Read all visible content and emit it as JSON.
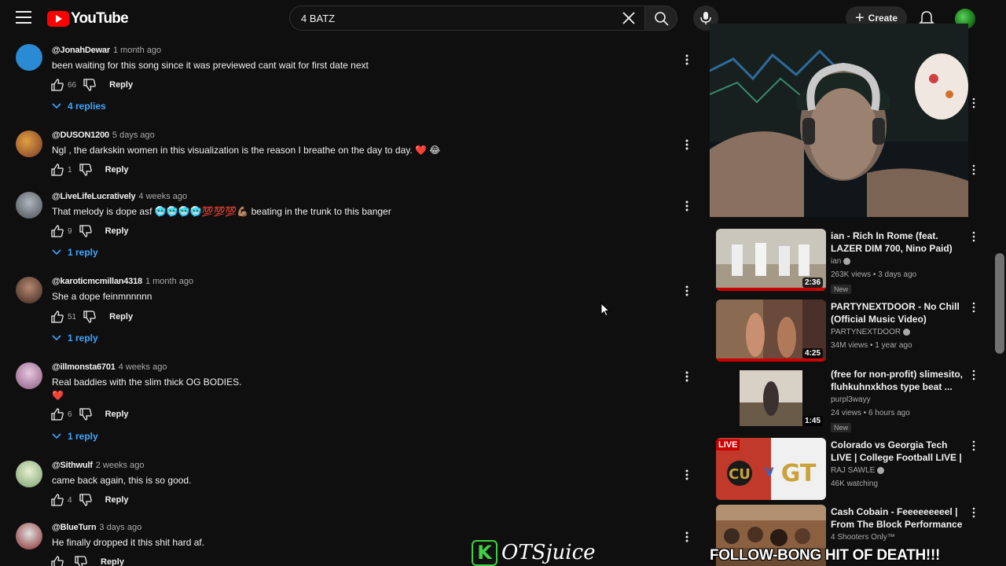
{
  "header": {
    "logo_text": "YouTube",
    "search_value": "4 BATZ",
    "create_label": "Create"
  },
  "comments": [
    {
      "author": "@JonahDewar",
      "time": "1 month ago",
      "text": "been waiting for this song since it was previewed cant wait for first date next",
      "likes": "66",
      "reply_label": "Reply",
      "replies": "4 replies",
      "avatar_color": "#2a8ad4"
    },
    {
      "author": "@DUSON1200",
      "time": "5 days ago",
      "text": "Ngl , the darkskin women in this visualization is the reason I breathe on the day to day. ❤️ 😂",
      "likes": "1",
      "reply_label": "Reply",
      "replies": "",
      "avatar_color": "#9b6b3a"
    },
    {
      "author": "@LiveLifeLucratively",
      "time": "4 weeks ago",
      "text": "That melody is dope asf 🥶🥶🥶🥶💯💯💯💪🏽 beating in the trunk  to this banger",
      "likes": "9",
      "reply_label": "Reply",
      "replies": "1 reply",
      "avatar_color": "#7a7f86"
    },
    {
      "author": "@karoticmcmillan4318",
      "time": "1 month ago",
      "text": "She a dope feinmnnnnn",
      "likes": "51",
      "reply_label": "Reply",
      "replies": "1 reply",
      "avatar_color": "#6b4a3a"
    },
    {
      "author": "@illmonsta6701",
      "time": "4 weeks ago",
      "text": "Real baddies with the slim thick OG BODIES.",
      "text2": "❤️",
      "likes": "6",
      "reply_label": "Reply",
      "replies": "1 reply",
      "avatar_color": "#c9a2c2"
    },
    {
      "author": "@Sithwulf",
      "time": "2 weeks ago",
      "text": "came back again, this is so good.",
      "likes": "4",
      "reply_label": "Reply",
      "replies": "",
      "avatar_color": "#a6c99a"
    },
    {
      "author": "@BlueTurn",
      "time": "3 days ago",
      "text": "He finally dropped it this shit hard af.",
      "likes": "",
      "reply_label": "Reply",
      "replies": "",
      "avatar_color": "#5a3a3a"
    }
  ],
  "videos": [
    {
      "title": "ian - Rich In Rome (feat. LAZER DIM 700, Nino Paid) (Official ...",
      "channel": "ian",
      "verified": true,
      "stats": "263K views • 3 days ago",
      "badge": "New",
      "duration": "2:36"
    },
    {
      "title": "PARTYNEXTDOOR - No Chill (Official Music Video)",
      "channel": "PARTYNEXTDOOR",
      "verified": true,
      "stats": "34M views • 1 year ago",
      "badge": "",
      "duration": "4:25"
    },
    {
      "title": "(free for non-profit) slimesito, fluhkuhnxkhos type beat ...",
      "channel": "purpl3wayy",
      "verified": false,
      "stats": "24 views • 6 hours ago",
      "badge": "New",
      "duration": "1:45"
    },
    {
      "title": "Colorado vs Georgia Tech LIVE | College Football LIVE | NCAAF...",
      "channel": "RAJ SAWLE",
      "verified": true,
      "stats": "46K watching",
      "badge": "",
      "duration": "",
      "live_label": "LIVE"
    },
    {
      "title": "Cash Cobain - Feeeeeeeeel | From The Block Performance ...",
      "channel": "4 Shooters Only™",
      "verified": false,
      "stats": "",
      "badge": "",
      "duration": ""
    }
  ],
  "overlay": {
    "watermark_k": "K",
    "watermark_text": "OTSjuice",
    "banner": "FOLLOW-BONG HIT OF DEATH!!!"
  },
  "colors": {
    "accent_link": "#3ea6ff",
    "brand_red": "#ff0000",
    "bg": "#0f0f0f"
  }
}
